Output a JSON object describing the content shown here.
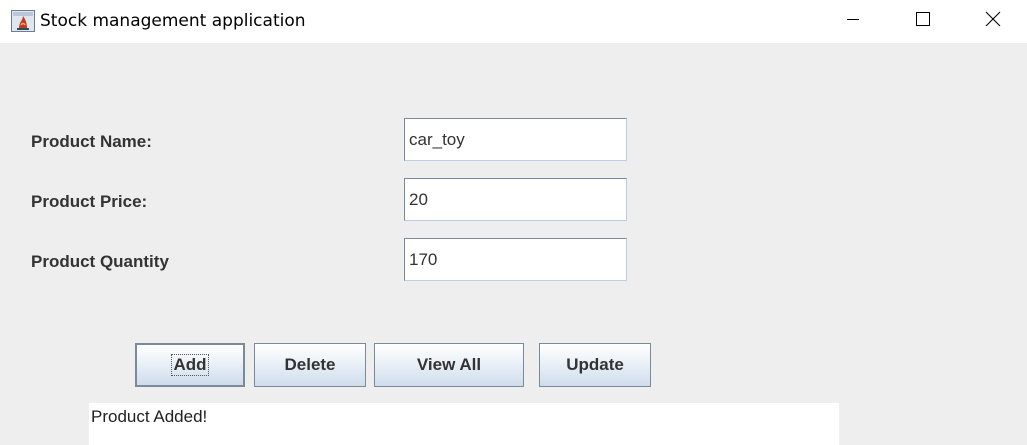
{
  "window": {
    "title": "Stock management application",
    "icon": "java-app-icon",
    "controls": {
      "minimize_icon": "minimize-icon",
      "maximize_icon": "maximize-icon",
      "close_icon": "close-icon"
    }
  },
  "form": {
    "name_label": "Product Name:",
    "name_value": "car_toy",
    "price_label": "Product Price:",
    "price_value": "20",
    "quantity_label": "Product Quantity",
    "quantity_value": "170"
  },
  "buttons": {
    "add": "Add",
    "delete": "Delete",
    "view_all": "View All",
    "update": "Update"
  },
  "status": {
    "message": "Product Added!"
  }
}
